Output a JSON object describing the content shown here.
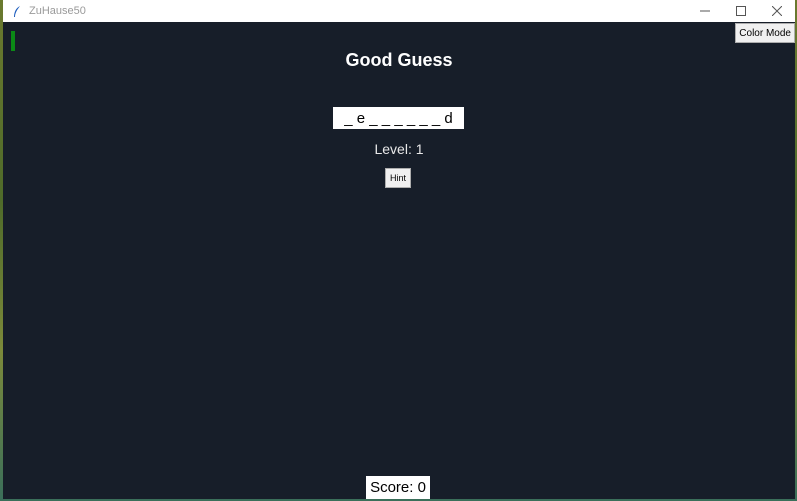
{
  "window": {
    "title": "ZuHause50",
    "icon": "feather-icon",
    "controls": [
      "minimize-icon",
      "maximize-icon",
      "close-icon"
    ]
  },
  "toolbar": {
    "color_mode_label": "Color Mode"
  },
  "game": {
    "heading": "Good Guess",
    "masked_word": "_ e _ _ _ _ _ _ d",
    "level_text": "Level: 1",
    "hint_label": "Hint",
    "score_text": "Score: 0"
  },
  "colors": {
    "background": "#171e29",
    "indicator": "#0b8a16",
    "text": "#ffffff"
  }
}
